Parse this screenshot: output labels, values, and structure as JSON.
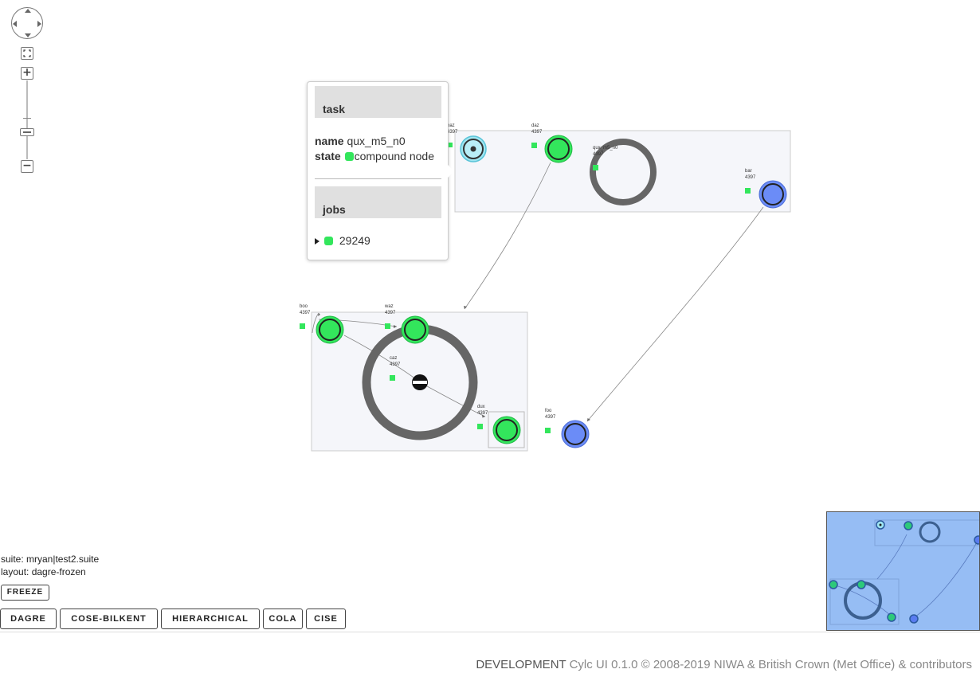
{
  "graph": {
    "nodes": [
      {
        "name": "baz",
        "cycle": "4397"
      },
      {
        "name": "daz",
        "cycle": "4397"
      },
      {
        "name": "qux_m5_n0",
        "cycle": "4397"
      },
      {
        "name": "bar",
        "cycle": "4397"
      },
      {
        "name": "boo",
        "cycle": "4397"
      },
      {
        "name": "waz",
        "cycle": "4397"
      },
      {
        "name": "caz",
        "cycle": "4397"
      },
      {
        "name": "dux",
        "cycle": "4397"
      },
      {
        "name": "foo",
        "cycle": "4397"
      }
    ],
    "colors": {
      "succeeded": "#33e65c",
      "waiting": "#6b8cf7",
      "queued": "#9fe6f2",
      "compound_ring": "#666666",
      "compound_bg": "#f5f6fa"
    }
  },
  "tooltip": {
    "task_header": "task",
    "name_label": "name",
    "name_value": "qux_m5_n0",
    "state_label": "state",
    "state_value": "compound node",
    "jobs_header": "jobs",
    "job_id": "29249"
  },
  "info": {
    "suite": "suite: mryan|test2.suite",
    "layout": "layout: dagre-frozen"
  },
  "buttons": {
    "freeze": "FREEZE",
    "layouts": [
      "DAGRE",
      "COSE-BILKENT",
      "HIERARCHICAL",
      "COLA",
      "CISE"
    ]
  },
  "footer": {
    "dev": "DEVELOPMENT",
    "text": "Cylc UI 0.1.0 © 2008-2019 NIWA & British Crown (Met Office) & contributors"
  },
  "icons": {
    "pan": "pan-icon",
    "fit": "fit-icon",
    "zoom_in": "plus-icon",
    "zoom_out": "minus-icon"
  }
}
